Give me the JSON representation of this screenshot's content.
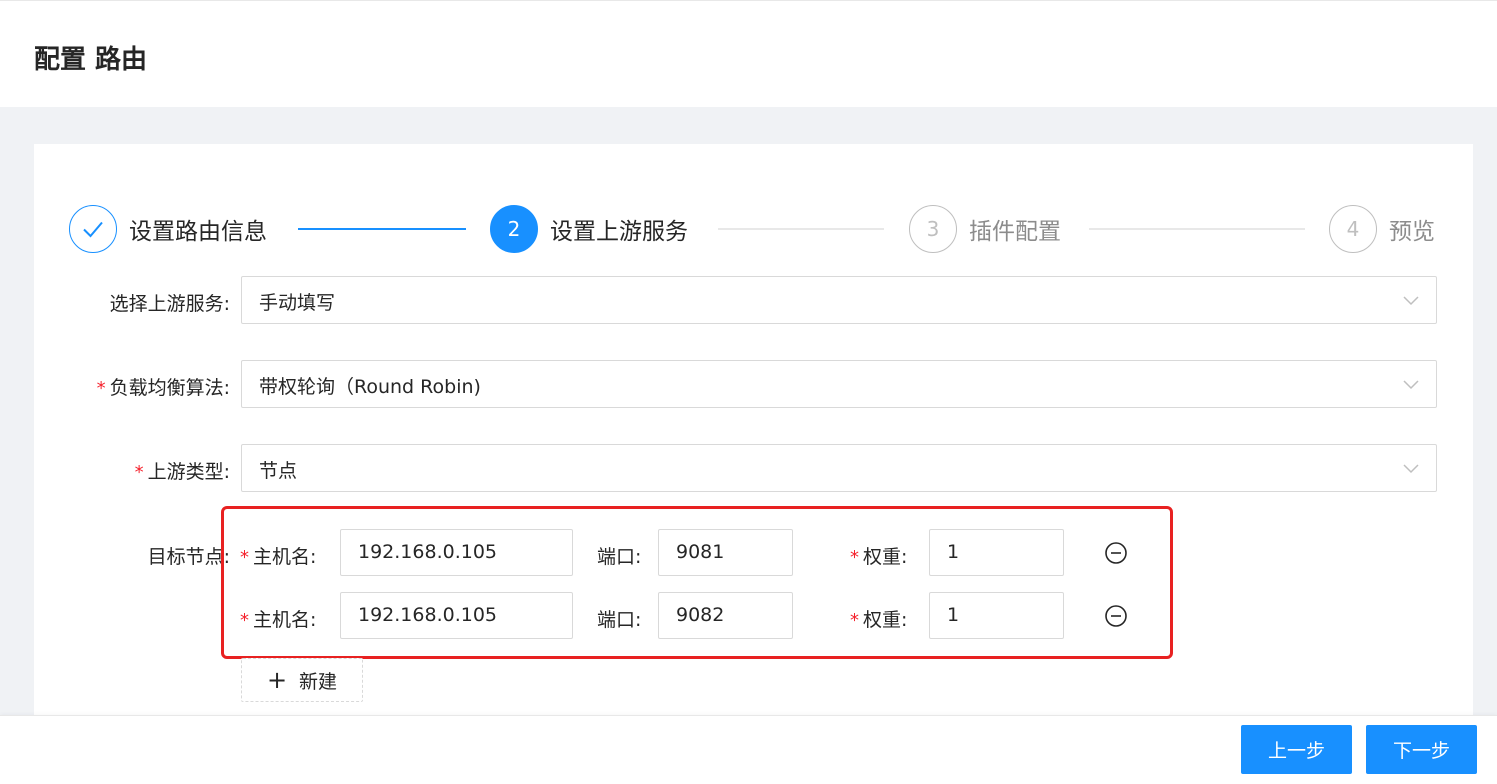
{
  "page": {
    "title": "配置 路由"
  },
  "steps": [
    {
      "index": "",
      "title": "设置路由信息",
      "status": "done"
    },
    {
      "index": "2",
      "title": "设置上游服务",
      "status": "active"
    },
    {
      "index": "3",
      "title": "插件配置",
      "status": "wait"
    },
    {
      "index": "4",
      "title": "预览",
      "status": "wait"
    }
  ],
  "form": {
    "upstream_service": {
      "label": "选择上游服务",
      "value": "手动填写",
      "required": false
    },
    "lb_algorithm": {
      "label": "负载均衡算法",
      "value": "带权轮询（Round Robin)",
      "required": true
    },
    "upstream_type": {
      "label": "上游类型",
      "value": "节点",
      "required": true
    },
    "nodes_label": "目标节点",
    "node_field_labels": {
      "host": "主机名",
      "port": "端口",
      "weight": "权重"
    },
    "nodes": [
      {
        "host": "192.168.0.105",
        "port": "9081",
        "weight": "1"
      },
      {
        "host": "192.168.0.105",
        "port": "9082",
        "weight": "1"
      }
    ],
    "add_label": "新建",
    "colon": ":",
    "required_mark": "*"
  },
  "footer": {
    "prev_label": "上一步",
    "next_label": "下一步"
  },
  "colors": {
    "primary": "#1890ff",
    "required": "#f5222d",
    "highlight": "#e82121"
  }
}
